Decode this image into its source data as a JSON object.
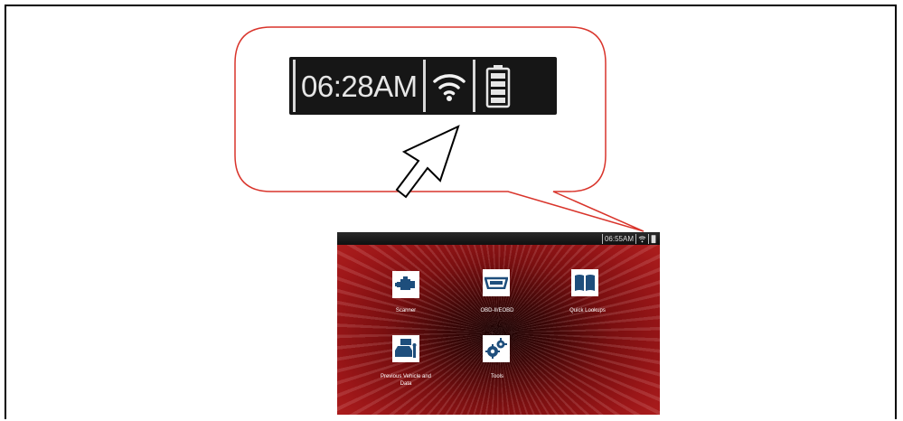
{
  "callout": {
    "time": "06:28AM",
    "icons": [
      "wifi-icon",
      "battery-icon"
    ],
    "pointer": "arrow-pointer-icon"
  },
  "device": {
    "status_bar": {
      "time": "06:55AM",
      "icons": [
        "wifi-icon",
        "battery-icon"
      ]
    },
    "tiles": [
      {
        "label": "Scanner",
        "icon": "engine-icon"
      },
      {
        "label": "OBD-II/EOBD",
        "icon": "obd-connector-icon"
      },
      {
        "label": "Quick Lookups",
        "icon": "book-icon"
      },
      {
        "label": "Previous Vehicle and Data",
        "icon": "car-history-icon"
      },
      {
        "label": "Tools",
        "icon": "gears-icon"
      }
    ]
  },
  "colors": {
    "callout_outline": "#d9342b",
    "background_red": "#9b1618",
    "status_bar": "#161616"
  }
}
